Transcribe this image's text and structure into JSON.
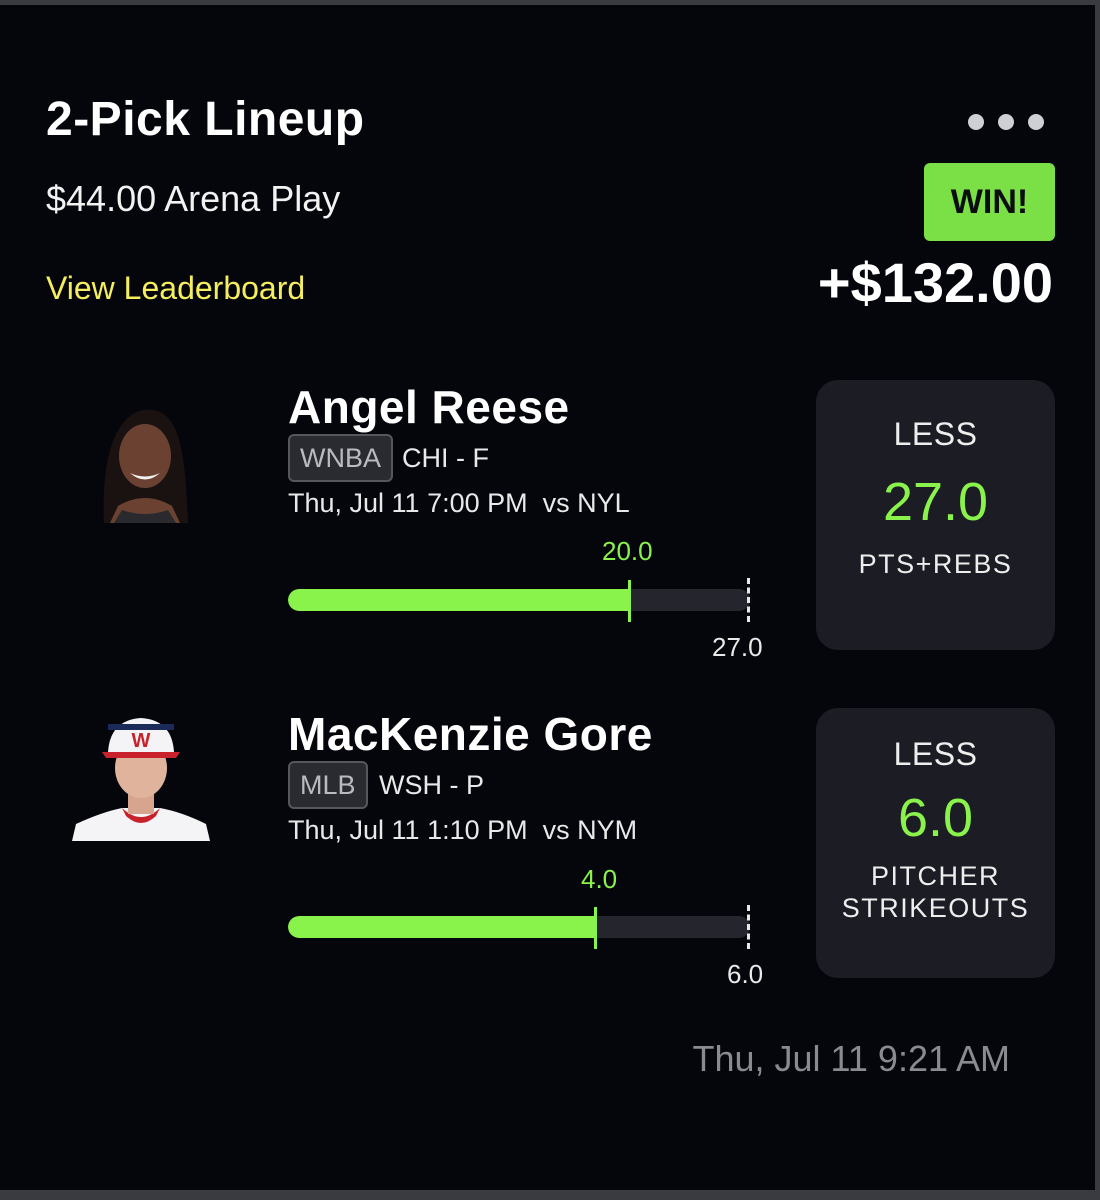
{
  "header": {
    "title": "2-Pick Lineup",
    "subtitle": "$44.00 Arena Play",
    "leaderboard_link": "View Leaderboard",
    "result_badge": "WIN!",
    "payout": "+$132.00",
    "more_icon": "more-horizontal-icon"
  },
  "picks": [
    {
      "name": "Angel Reese",
      "league": "WNBA",
      "team_pos": "CHI - F",
      "game_time": "Thu, Jul 11 7:00 PM",
      "opponent": "vs NYL",
      "current": "20.0",
      "line": "27.0",
      "progress_fraction": 0.74,
      "direction": "LESS",
      "projection": "27.0",
      "stat": "PTS+REBS"
    },
    {
      "name": "MacKenzie Gore",
      "league": "MLB",
      "team_pos": "WSH - P",
      "game_time": "Thu, Jul 11 1:10 PM",
      "opponent": "vs NYM",
      "current": "4.0",
      "line": "6.0",
      "progress_fraction": 0.667,
      "direction": "LESS",
      "projection": "6.0",
      "stat_line1": "PITCHER",
      "stat_line2": "STRIKEOUTS"
    }
  ],
  "footer": {
    "timestamp": "Thu, Jul 11 9:21 AM"
  },
  "colors": {
    "background": "#05060c",
    "accent_green": "#8af34b",
    "win_badge": "#7be045",
    "link_yellow": "#f5ee5f",
    "card": "#1c1d24"
  }
}
